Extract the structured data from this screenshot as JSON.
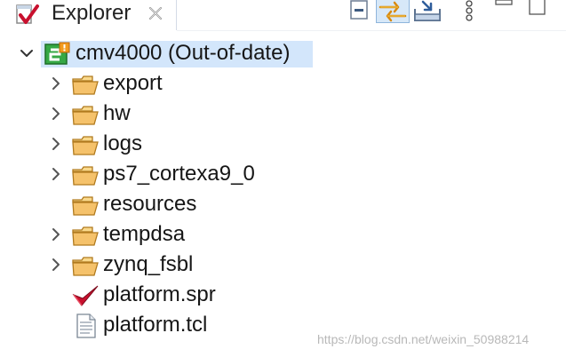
{
  "view": {
    "tab_title": "Explorer",
    "tab_icon": "explorer-icon",
    "close_icon": "close-icon",
    "toolbar": [
      {
        "name": "collapse-all-button",
        "icon": "collapse-all-icon"
      },
      {
        "name": "link-with-editor-button",
        "icon": "link-with-editor-icon",
        "active": true
      },
      {
        "name": "filter-button",
        "icon": "filter-import-icon"
      },
      {
        "name": "view-menu-button",
        "icon": "more-vertical-icon"
      },
      {
        "name": "minimize-button",
        "icon": "minimize-icon"
      },
      {
        "name": "maximize-button",
        "icon": "maximize-icon"
      }
    ]
  },
  "tree": {
    "root": {
      "label": "cmv4000 (Out-of-date)",
      "icon": "platform-project-icon",
      "expanded": true,
      "selected": true
    },
    "children": [
      {
        "label": "export",
        "icon": "folder-icon",
        "expandable": true
      },
      {
        "label": "hw",
        "icon": "folder-icon",
        "expandable": true
      },
      {
        "label": "logs",
        "icon": "folder-icon",
        "expandable": true
      },
      {
        "label": "ps7_cortexa9_0",
        "icon": "folder-icon",
        "expandable": true
      },
      {
        "label": "resources",
        "icon": "folder-icon",
        "expandable": false
      },
      {
        "label": "tempdsa",
        "icon": "folder-icon",
        "expandable": true
      },
      {
        "label": "zynq_fsbl",
        "icon": "folder-icon",
        "expandable": true
      },
      {
        "label": "platform.spr",
        "icon": "spr-file-icon",
        "expandable": false
      },
      {
        "label": "platform.tcl",
        "icon": "text-file-icon",
        "expandable": false
      }
    ]
  },
  "watermark": "https://blog.csdn.net/weixin_50988214",
  "colors": {
    "selection": "#d3e6fb",
    "folder": "#f5c26b",
    "folder_outline": "#b07a1e",
    "project_green": "#36a845",
    "warning_orange": "#f29b1d"
  }
}
